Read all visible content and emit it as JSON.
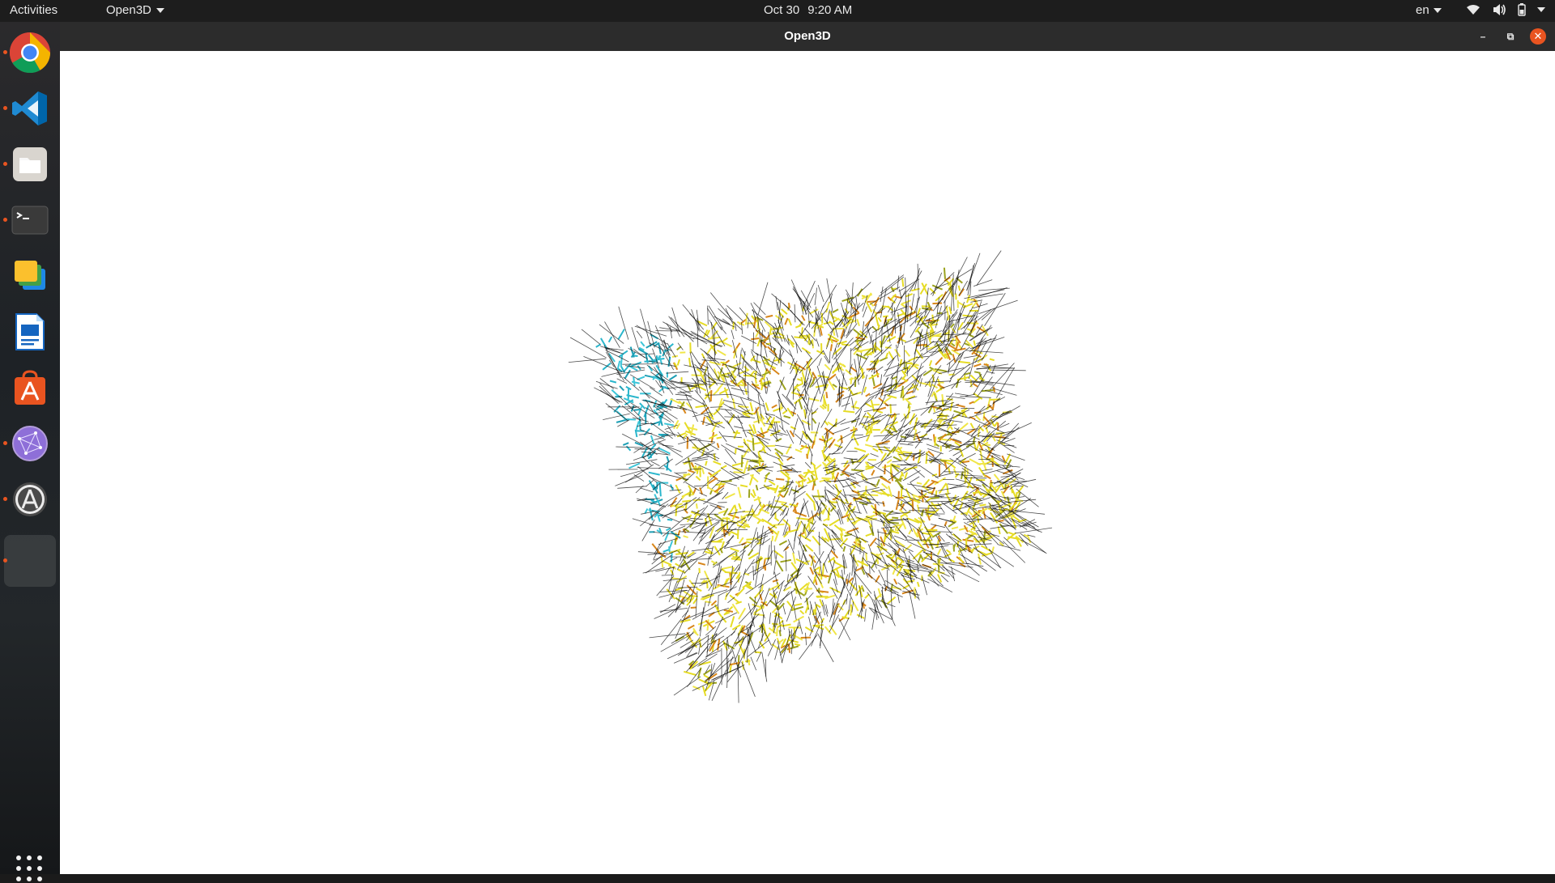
{
  "topbar": {
    "activities": "Activities",
    "app_menu": "Open3D",
    "date": "Oct 30",
    "time": "9:20 AM",
    "language": "en"
  },
  "dock": {
    "apps": [
      {
        "name": "Google Chrome",
        "icon": "chrome-icon"
      },
      {
        "name": "Visual Studio Code",
        "icon": "vscode-icon"
      },
      {
        "name": "Files",
        "icon": "files-icon"
      },
      {
        "name": "Terminal",
        "icon": "terminal-icon"
      },
      {
        "name": "Slides",
        "icon": "slides-icon"
      },
      {
        "name": "LibreOffice Writer",
        "icon": "writer-icon"
      },
      {
        "name": "Ubuntu Software",
        "icon": "software-icon"
      },
      {
        "name": "Network App",
        "icon": "network-icon"
      },
      {
        "name": "Software Updater",
        "icon": "updater-icon"
      },
      {
        "name": "Open3D",
        "icon": "open3d-window-icon"
      }
    ],
    "show_apps": "Show Applications"
  },
  "window": {
    "title": "Open3D",
    "minimize": "–",
    "restore": "⧉",
    "close": "✕"
  },
  "colors": {
    "accent": "#e95420",
    "topbar_bg": "#1d1d1d",
    "titlebar_bg": "#2c2c2c",
    "viewport_bg": "#ffffff"
  }
}
